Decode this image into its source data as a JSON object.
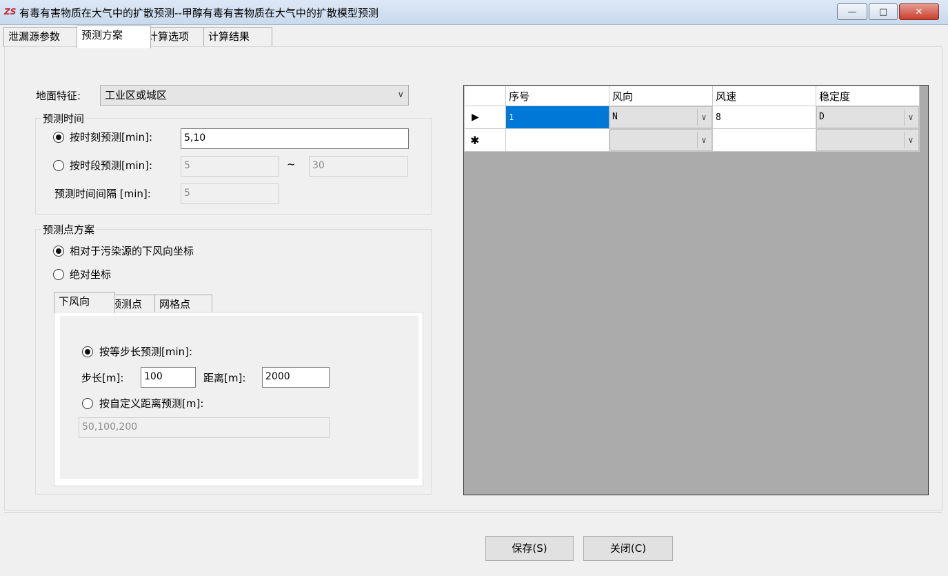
{
  "window": {
    "title": "有毒有害物质在大气中的扩散预测--甲醇有毒有害物质在大气中的扩散模型预测",
    "app_icon": "ZS",
    "minimize_icon": "—",
    "maximize_icon": "□",
    "close_icon": "✕"
  },
  "tabs": [
    "泄漏源参数",
    "预测方案",
    "计算选项",
    "计算结果"
  ],
  "left": {
    "terrain_label": "地面特征:",
    "terrain_value": "工业区或城区",
    "time_group": {
      "legend": "预测时间",
      "by_moment_label": "按时刻预测[min]:",
      "by_moment_value": "5,10",
      "by_period_label": "按时段预测[min]:",
      "period_from": "5",
      "tilde": "~",
      "period_to": "30",
      "interval_label": "预测时间间隔 [min]:",
      "interval_value": "5"
    },
    "point_group": {
      "legend": "预测点方案",
      "relative_label": "相对于污染源的下风向坐标",
      "absolute_label": "绝对坐标",
      "subtabs": [
        "下风向",
        "预测点",
        "网格点"
      ],
      "equal_step_label": "按等步长预测[min]:",
      "step_label": "步长[m]:",
      "step_value": "100",
      "distance_label": "距离[m]:",
      "distance_value": "2000",
      "custom_label": "按自定义距离预测[m]:",
      "custom_value": "50,100,200"
    }
  },
  "grid": {
    "headers": [
      "序号",
      "风向",
      "风速",
      "稳定度"
    ],
    "current_row_marker": "▶",
    "new_row_marker": "✱",
    "rows": [
      {
        "index": "1",
        "direction": "N",
        "speed": "8",
        "stability": "D"
      }
    ]
  },
  "buttons": {
    "save": "保存(S)",
    "close": "关闭(C)"
  },
  "colors": {
    "selection": "#0078d7",
    "grid_background": "#ababab"
  }
}
